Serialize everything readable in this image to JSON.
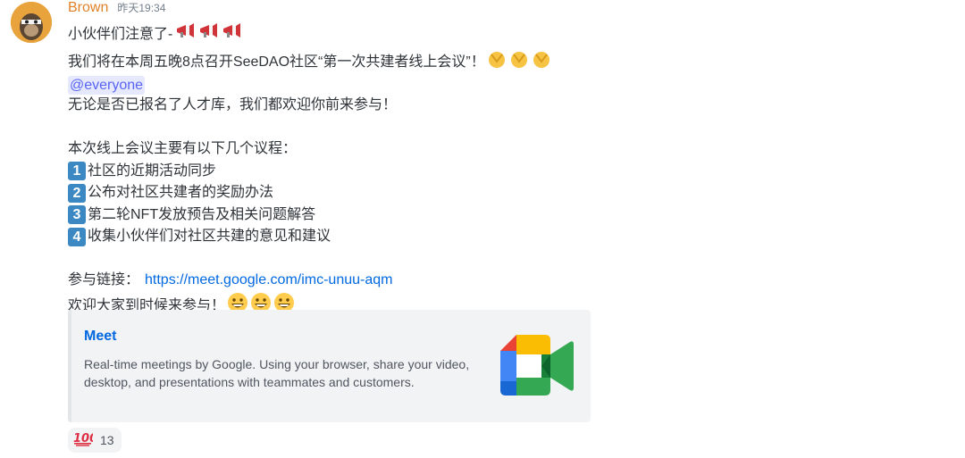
{
  "message": {
    "username": "Brown",
    "timestamp": "昨天19:34",
    "line1": "小伙伴们注意了-",
    "line2": "我们将在本周五晚8点召开SeeDAO社区“第一次共建者线上会议”！",
    "mention": "@everyone",
    "line4": "无论是否已报名了人才库，我们都欢迎你前来参与！",
    "agenda_heading": "本次线上会议主要有以下几个议程：",
    "agenda": [
      {
        "num": "1",
        "text": "社区的近期活动同步"
      },
      {
        "num": "2",
        "text": "公布对社区共建者的奖励办法"
      },
      {
        "num": "3",
        "text": "第二轮NFT发放预告及相关问题解答"
      },
      {
        "num": "4",
        "text": "收集小伙伴们对社区共建的意见和建议"
      }
    ],
    "link_label": "参与链接：",
    "link_url": "https://meet.google.com/imc-unuu-aqm",
    "closing": "欢迎大家到时候来参与！"
  },
  "embed": {
    "title": "Meet",
    "description": "Real-time meetings by Google. Using your browser, share your video, desktop, and presentations with teammates and customers."
  },
  "reaction": {
    "emoji_name": "hundred-points-icon",
    "count": "13"
  },
  "colors": {
    "username": "#e0822a",
    "link": "#0068e0",
    "mention_bg": "#e6e9fd",
    "mention_text": "#5865f2",
    "embed_bg": "#f2f3f5",
    "number_box": "#3b88c3"
  },
  "icons": [
    "megaphone-icon",
    "clapping-hands-icon",
    "grinning-face-icon",
    "google-meet-logo",
    "hundred-points-icon"
  ]
}
